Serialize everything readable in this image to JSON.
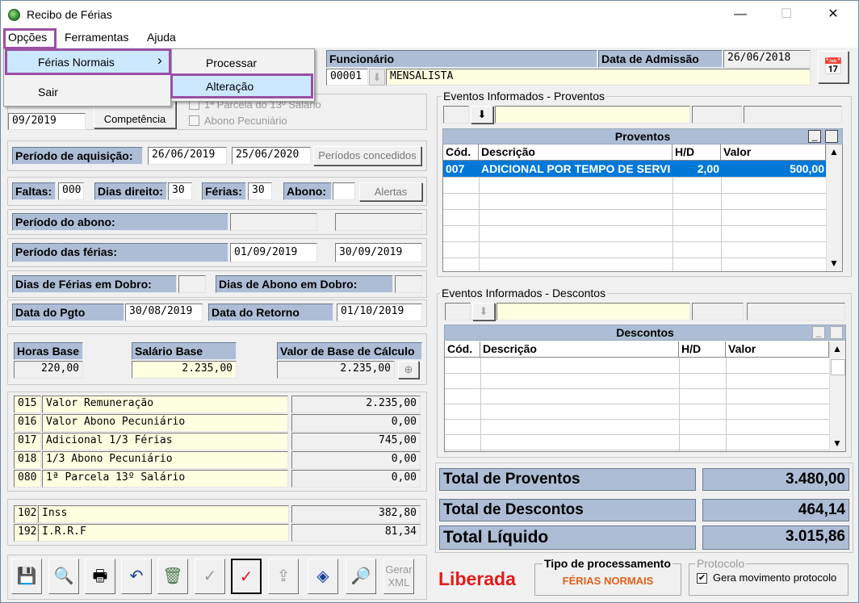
{
  "window": {
    "title": "Recibo de Férias",
    "minimize": "—",
    "maximize": "☐",
    "close": "✕"
  },
  "menu": {
    "opcoes": "Opções",
    "ferramentas": "Ferramentas",
    "ajuda": "Ajuda"
  },
  "dropdown": {
    "ferias_normais": "Férias Normais",
    "sair": "Sair",
    "arrow": "›"
  },
  "submenu": {
    "processar": "Processar",
    "alteracao": "Alteração"
  },
  "employee": {
    "funcionario_label": "Funcionário",
    "admissao_label": "Data de Admissão",
    "admissao": "26/06/2018",
    "codigo": "00001",
    "nome": "MENSALISTA"
  },
  "competencia": {
    "value": "09/2019",
    "button": "Competência",
    "parcela13": "1ª Parcela do 13º Salário",
    "abono": "Abono Pecuniário"
  },
  "aquisicao": {
    "label": "Período de aquisição:",
    "inicio": "26/06/2019",
    "fim": "25/06/2020",
    "button": "Períodos concedidos"
  },
  "dias": {
    "faltas_label": "Faltas:",
    "faltas": "000",
    "direito_label": "Dias direito:",
    "direito": "30",
    "ferias_label": "Férias:",
    "ferias": "30",
    "abono_label": "Abono:",
    "abono": "",
    "alertas": "Alertas"
  },
  "periodo_abono": {
    "label": "Período do abono:",
    "inicio": "",
    "fim": ""
  },
  "periodo_ferias": {
    "label": "Período das férias:",
    "inicio": "01/09/2019",
    "fim": "30/09/2019"
  },
  "dobro": {
    "ferias_label": "Dias de Férias em Dobro:",
    "ferias": "",
    "abono_label": "Dias de Abono em Dobro:",
    "abono": ""
  },
  "pgto": {
    "label": "Data do Pgto",
    "value": "30/08/2019",
    "retorno_label": "Data do Retorno",
    "retorno": "01/10/2019"
  },
  "base": {
    "horas_label": "Horas Base",
    "horas": "220,00",
    "salario_label": "Salário Base",
    "salario": "2.235,00",
    "calculo_label": "Valor de Base de Cálculo",
    "calculo": "2.235,00"
  },
  "calc_lines": [
    {
      "code": "015",
      "desc": "Valor Remuneração",
      "value": "2.235,00"
    },
    {
      "code": "016",
      "desc": "Valor Abono Pecuniário",
      "value": "0,00"
    },
    {
      "code": "017",
      "desc": "Adicional 1/3 Férias",
      "value": "745,00"
    },
    {
      "code": "018",
      "desc": "1/3 Abono Pecuniário",
      "value": "0,00"
    },
    {
      "code": "080",
      "desc": "1ª Parcela 13º Salário",
      "value": "0,00"
    }
  ],
  "desc_lines": [
    {
      "code": "102",
      "desc": "Inss",
      "value": "382,80"
    },
    {
      "code": "192",
      "desc": "I.R.R.F",
      "value": "81,34"
    }
  ],
  "proventos": {
    "group": "Eventos Informados - Proventos",
    "title": "Proventos",
    "cols": [
      "Cód.",
      "Descrição",
      "H/D",
      "Valor"
    ],
    "rows": [
      {
        "cod": "007",
        "desc": "ADICIONAL POR TEMPO DE SERVI",
        "hd": "2,00",
        "valor": "500,00"
      }
    ]
  },
  "descontos": {
    "group": "Eventos Informados - Descontos",
    "title": "Descontos",
    "cols": [
      "Cód.",
      "Descrição",
      "H/D",
      "Valor"
    ],
    "rows": []
  },
  "totais": {
    "proventos_label": "Total de Proventos",
    "proventos": "3.480,00",
    "descontos_label": "Total de Descontos",
    "descontos": "464,14",
    "liquido_label": "Total Líquido",
    "liquido": "3.015,86"
  },
  "status": {
    "liberada": "Liberada",
    "tipo_label": "Tipo de processamento",
    "tipo": "FÉRIAS NORMAIS",
    "protocolo_group": "Protocolo",
    "protocolo_chk": "Gera movimento protocolo"
  },
  "toolbar": {
    "gerar_xml": "Gerar XML"
  },
  "colors": {
    "label_bg": "#adbdd6",
    "selection": "#0078d7",
    "highlight_border": "#9b4fa6",
    "liberada": "#e31b1b",
    "tipo": "#e0601b"
  }
}
